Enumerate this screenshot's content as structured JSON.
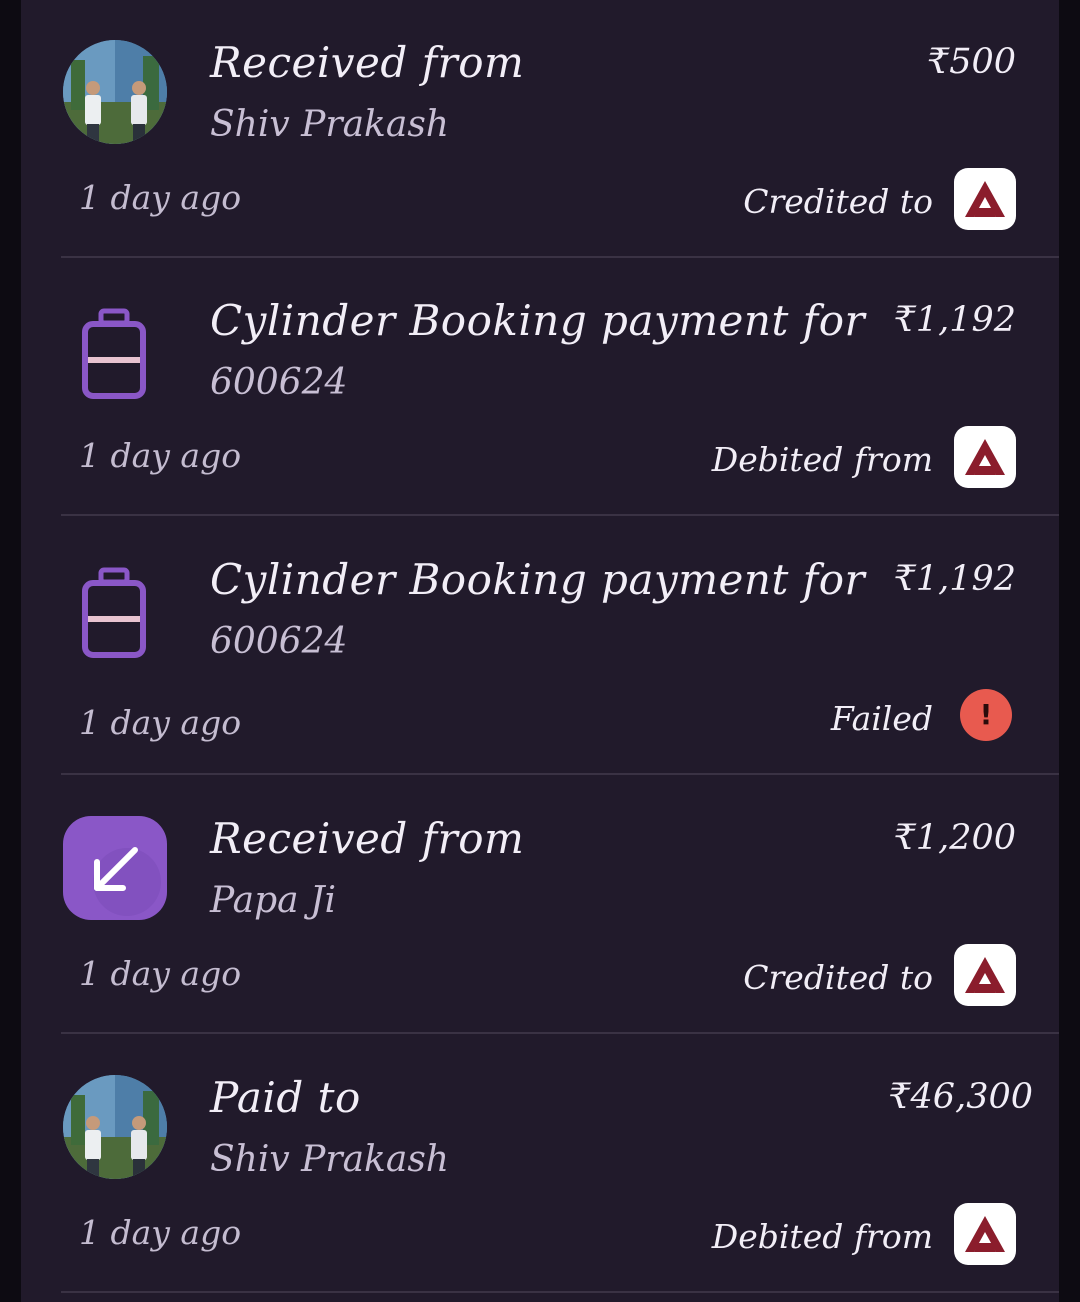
{
  "transactions": [
    {
      "kind": "avatar",
      "title": "Received from",
      "subtitle": "Shiv Prakash",
      "amount": "₹500",
      "time": "1 day ago",
      "status": "Credited to",
      "status_icon": "axis-bank-icon"
    },
    {
      "kind": "cylinder",
      "title": "Cylinder Booking payment for",
      "subtitle": "600624",
      "amount": "₹1,192",
      "time": "1 day ago",
      "status": "Debited from",
      "status_icon": "axis-bank-icon"
    },
    {
      "kind": "cylinder",
      "title": "Cylinder Booking payment for",
      "subtitle": "600624",
      "amount": "₹1,192",
      "time": "1 day ago",
      "status": "Failed",
      "status_icon": "failed-alert-icon",
      "failed_mark": "!"
    },
    {
      "kind": "received-arrow",
      "title": "Received from",
      "subtitle": "Papa Ji",
      "amount": "₹1,200",
      "time": "1 day ago",
      "status": "Credited to",
      "status_icon": "axis-bank-icon"
    },
    {
      "kind": "avatar",
      "title": "Paid to",
      "subtitle": "Shiv Prakash",
      "amount": "₹46,300",
      "time": "1 day ago",
      "status": "Debited from",
      "status_icon": "axis-bank-icon"
    }
  ],
  "colors": {
    "background": "#211a2b",
    "icon_purple": "#8a57c7",
    "failed_red": "#e85a4f",
    "bank_maroon": "#8b1d2c"
  }
}
